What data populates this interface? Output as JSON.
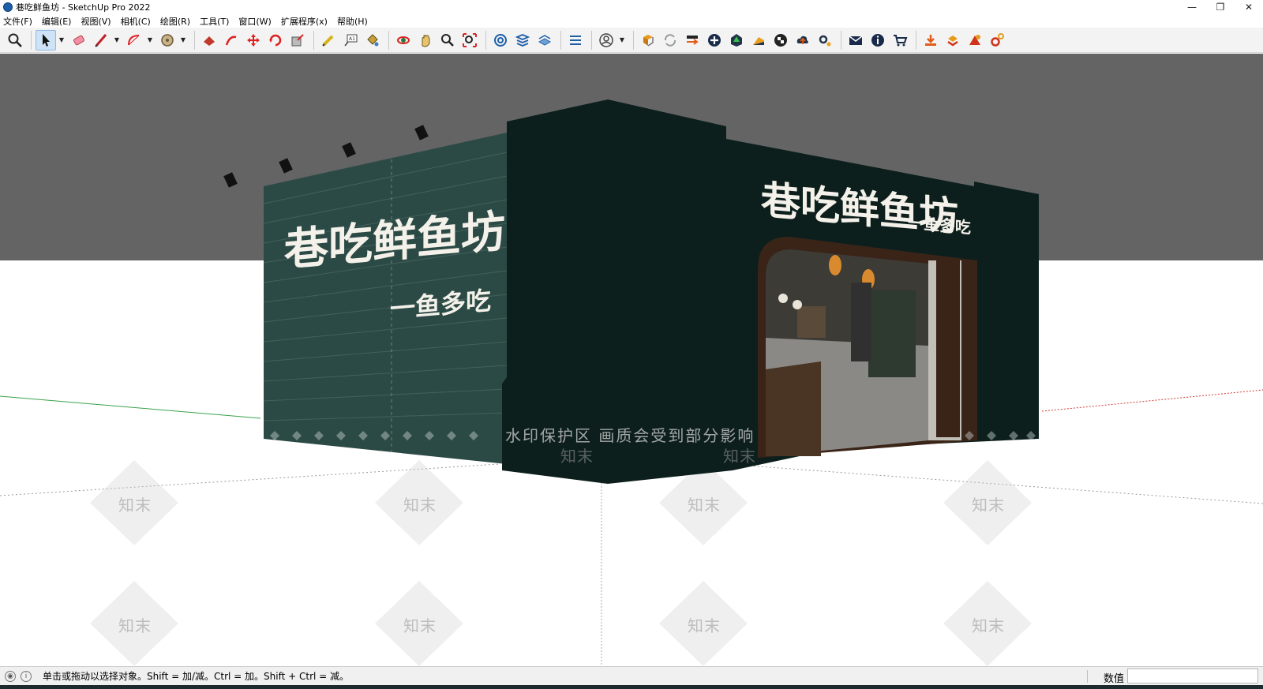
{
  "window": {
    "title": "巷吃鲜鱼坊 - SketchUp Pro 2022",
    "controls": {
      "minimize": "—",
      "restore": "❐",
      "close": "✕"
    }
  },
  "menu": [
    "文件(F)",
    "编辑(E)",
    "视图(V)",
    "相机(C)",
    "绘图(R)",
    "工具(T)",
    "窗口(W)",
    "扩展程序(x)",
    "帮助(H)"
  ],
  "toolbar": {
    "tools": [
      "zoom-icon",
      "select-icon",
      "eraser-icon",
      "pencil-icon",
      "arc-icon",
      "tape-icon",
      "paint-icon",
      "followme-icon",
      "move-icon",
      "rotate-icon",
      "scale-icon",
      "tape-measure-icon",
      "text-icon",
      "paint-bucket-icon",
      "orbit-icon",
      "pan-icon",
      "zoom-window-icon",
      "zoom-extents-icon",
      "warehouse-icon",
      "layers-icon",
      "styles-icon",
      "sections-icon",
      "account-icon",
      "extension-warehouse-icon",
      "refresh-icon",
      "export-icon",
      "add-icon",
      "tree-icon",
      "palette-icon",
      "checker-icon",
      "cloud-icon",
      "settings-icon",
      "mail-icon",
      "info-icon",
      "cart-icon",
      "import-icon",
      "upload-icon",
      "render-icon",
      "gear-icon"
    ]
  },
  "scene": {
    "sign_main": "巷吃鲜鱼坊",
    "sign_sub": "一鱼多吃",
    "watermark_main": "水印保护区   画质会受到部分影响",
    "watermark_tile": "知末",
    "colors": {
      "facade": "#0c1f1c",
      "brick": "#2c4a45",
      "sky": "#646464",
      "sign": "#f4f1ea"
    }
  },
  "status": {
    "hint": "单击或拖动以选择对象。Shift = 加/减。Ctrl = 加。Shift + Ctrl = 减。",
    "measure_label": "数值",
    "measure_value": ""
  }
}
